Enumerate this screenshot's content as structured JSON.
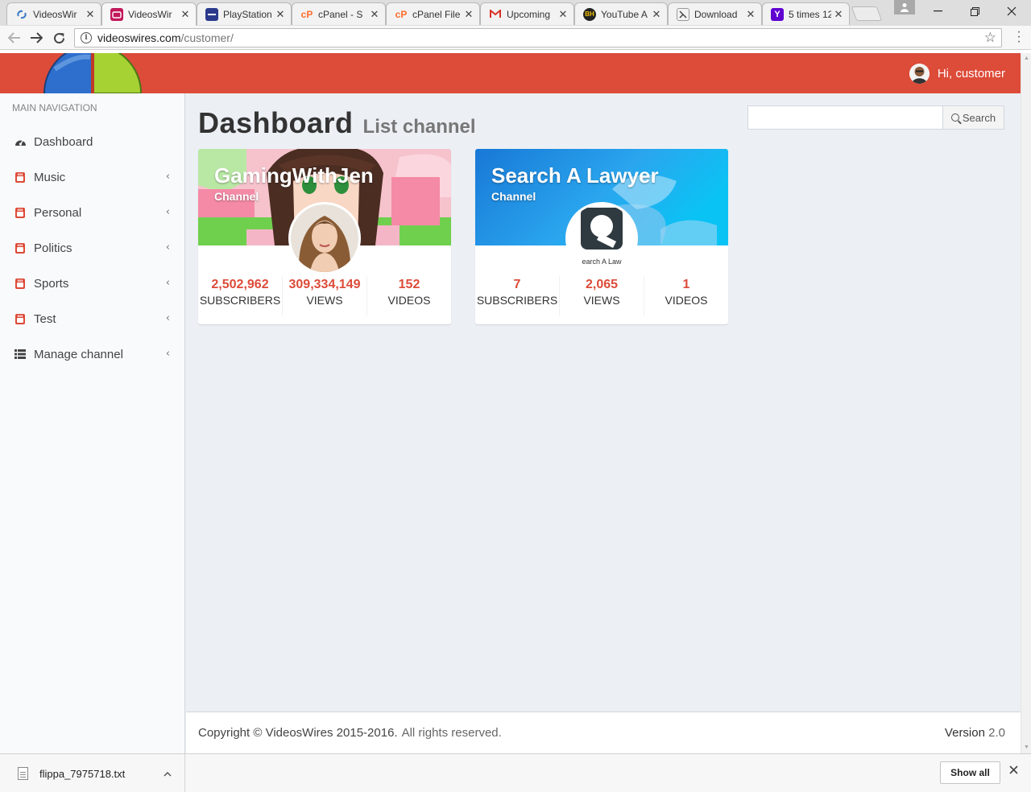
{
  "browser": {
    "tabs": [
      {
        "title": "VideosWir",
        "favicon": "swirl-icon",
        "color": "#3d7ac7"
      },
      {
        "title": "VideosWir",
        "favicon": "tv-icon",
        "color": "#c2185b",
        "active": true
      },
      {
        "title": "PlayStation",
        "favicon": "dash-icon",
        "color": "#2b3a8c"
      },
      {
        "title": "cPanel - S",
        "favicon": "cpanel-icon",
        "color": "#ff6c2c"
      },
      {
        "title": "cPanel File",
        "favicon": "cpanel-icon",
        "color": "#ff6c2c"
      },
      {
        "title": "Upcoming",
        "favicon": "gmail-icon",
        "color": "#d93025"
      },
      {
        "title": "YouTube A",
        "favicon": "bh-icon",
        "color": "#222222"
      },
      {
        "title": "Download",
        "favicon": "page-icon",
        "color": "#555555"
      },
      {
        "title": "5 times 12",
        "favicon": "yahoo-icon",
        "color": "#6001d2"
      }
    ],
    "address": {
      "host": "videoswires.com",
      "path": "/customer/"
    }
  },
  "header": {
    "greeting": "Hi, customer",
    "accent": "#dd4b39"
  },
  "sidebar": {
    "heading": "MAIN NAVIGATION",
    "items": [
      {
        "label": "Dashboard",
        "icon": "dashboard-icon",
        "expandable": false
      },
      {
        "label": "Music",
        "icon": "youtube-icon",
        "expandable": true
      },
      {
        "label": "Personal",
        "icon": "youtube-icon",
        "expandable": true
      },
      {
        "label": "Politics",
        "icon": "youtube-icon",
        "expandable": true
      },
      {
        "label": "Sports",
        "icon": "youtube-icon",
        "expandable": true
      },
      {
        "label": "Test",
        "icon": "youtube-icon",
        "expandable": true
      },
      {
        "label": "Manage channel",
        "icon": "list-icon",
        "expandable": true
      }
    ]
  },
  "page": {
    "title": "Dashboard",
    "subtitle": "List channel"
  },
  "search": {
    "value": "",
    "placeholder": "",
    "button_label": "Search"
  },
  "channels": [
    {
      "name": "GamingWithJen",
      "type": "Channel",
      "subscribers": "2,502,962",
      "subscribers_label": "SUBSCRIBERS",
      "views": "309,334,149",
      "views_label": "VIEWS",
      "videos": "152",
      "videos_label": "VIDEOS"
    },
    {
      "name": "Search A Lawyer",
      "type": "Channel",
      "avatar_text": "earch A Law",
      "subscribers": "7",
      "subscribers_label": "SUBSCRIBERS",
      "views": "2,065",
      "views_label": "VIEWS",
      "videos": "1",
      "videos_label": "VIDEOS"
    }
  ],
  "footer": {
    "copyright": "Copyright © VideosWires 2015-2016.",
    "rights": "All rights reserved.",
    "version_label": "Version",
    "version": "2.0"
  },
  "downloads": {
    "file": "flippa_7975718.txt",
    "show_all": "Show all"
  }
}
